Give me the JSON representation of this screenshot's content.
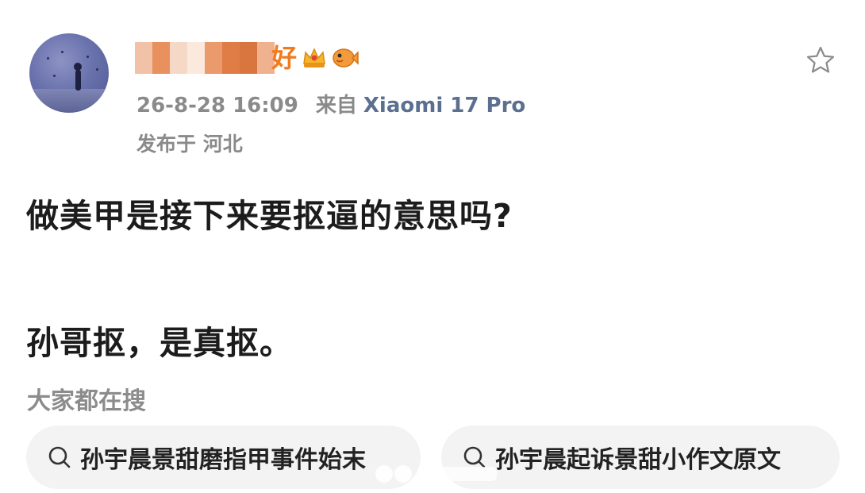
{
  "user": {
    "name_visible": "好",
    "avatar_alt": "avatar",
    "badges": [
      "crown-badge-icon",
      "fish-badge-icon"
    ]
  },
  "post_meta": {
    "timestamp": "26-8-28 16:09",
    "from_label": "来自",
    "device": "Xiaomi 17 Pro",
    "location": "发布于 河北"
  },
  "post": {
    "line1": "做美甲是接下来要抠逼的意思吗?",
    "line2": "孙哥抠，是真抠。"
  },
  "searches": {
    "heading": "大家都在搜",
    "items": [
      {
        "label": "孙宇晨景甜磨指甲事件始末",
        "icon": "search-icon"
      },
      {
        "label": "孙宇晨起诉景甜小作文原文",
        "icon": "search-icon"
      }
    ]
  },
  "colors": {
    "name": "#f07a1c",
    "device": "#5b6f8f",
    "muted": "#8a8a8a",
    "chip_bg": "#f3f3f3"
  }
}
